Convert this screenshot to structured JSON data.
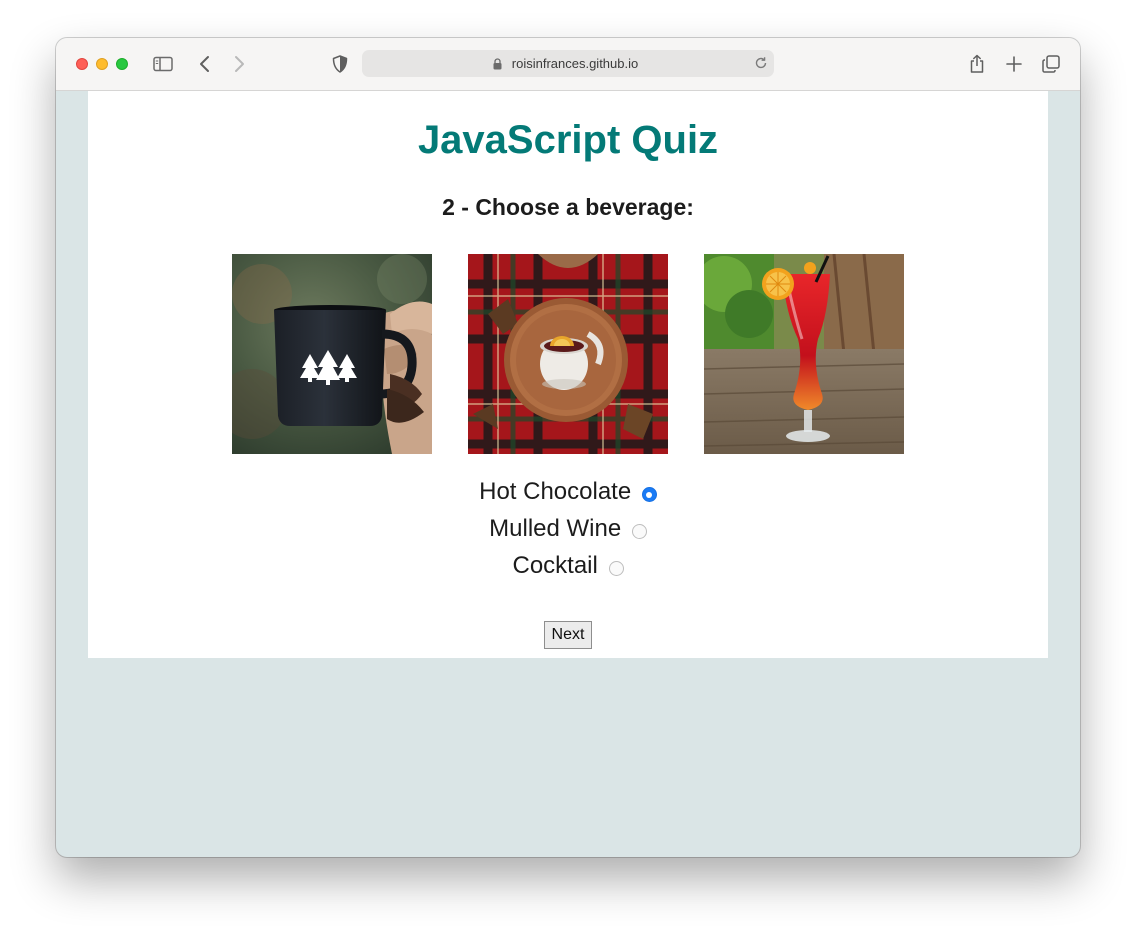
{
  "browser": {
    "url": "roisinfrances.github.io",
    "icons": [
      "sidebar-icon",
      "back-icon",
      "forward-icon",
      "shield-icon",
      "lock-icon",
      "reload-icon",
      "share-icon",
      "new-tab-icon",
      "tabs-overview-icon"
    ]
  },
  "quiz": {
    "title": "JavaScript Quiz",
    "question": "2 - Choose a beverage:",
    "options": [
      {
        "label": "Hot Chocolate",
        "selected": true
      },
      {
        "label": "Mulled Wine",
        "selected": false
      },
      {
        "label": "Cocktail",
        "selected": false
      }
    ],
    "next_label": "Next"
  },
  "colors": {
    "title": "#047a77",
    "page_background": "#dae5e6",
    "radio_selected": "#1a7bf5"
  }
}
